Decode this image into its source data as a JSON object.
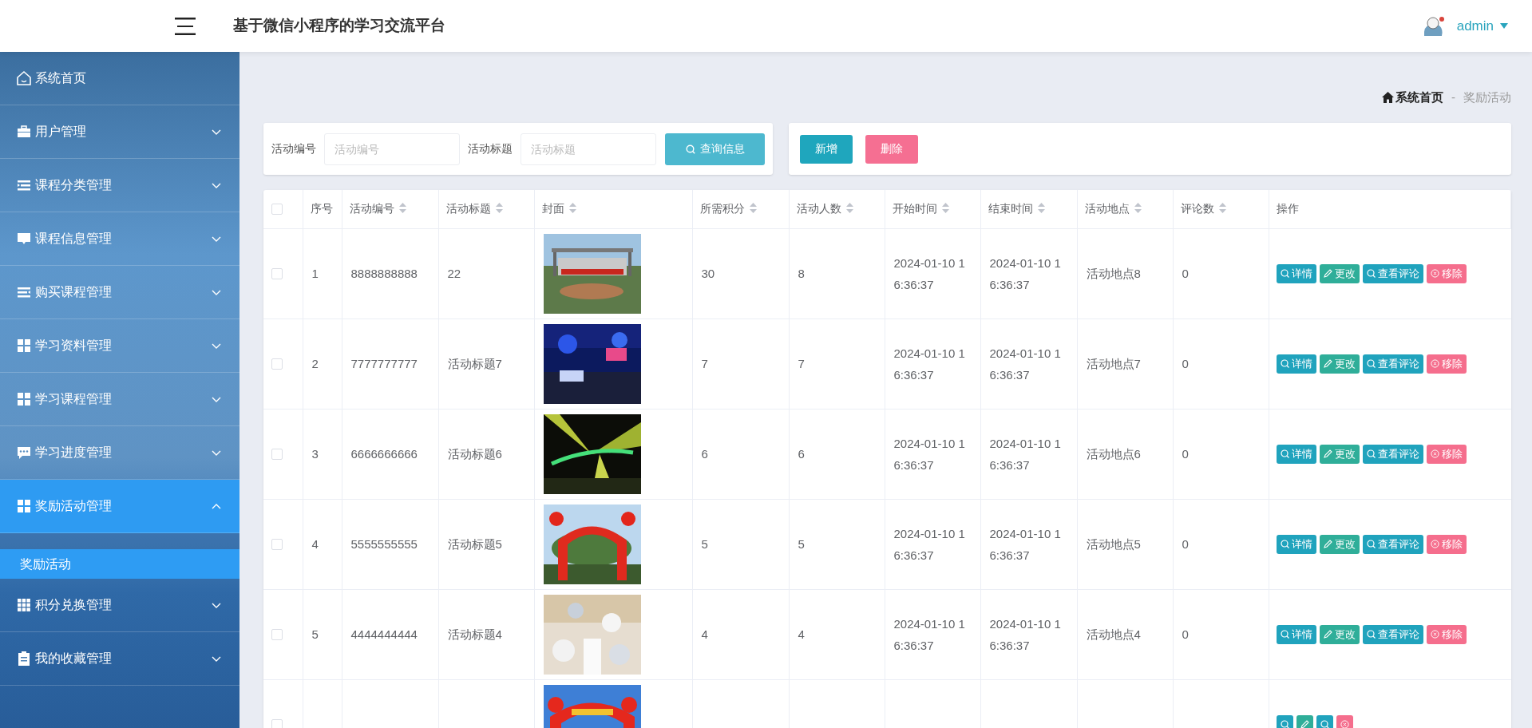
{
  "header": {
    "title": "基于微信小程序的学习交流平台",
    "user": "admin"
  },
  "sidebar": {
    "items": [
      {
        "label": "系统首页",
        "selected": false
      },
      {
        "label": "用户管理",
        "expanded": false,
        "selected": false
      },
      {
        "label": "课程分类管理",
        "expanded": false,
        "selected": false
      },
      {
        "label": "课程信息管理",
        "expanded": false,
        "selected": false
      },
      {
        "label": "购买课程管理",
        "expanded": false,
        "selected": false
      },
      {
        "label": "学习资料管理",
        "expanded": false,
        "selected": false
      },
      {
        "label": "学习课程管理",
        "expanded": false,
        "selected": false
      },
      {
        "label": "学习进度管理",
        "expanded": false,
        "selected": false
      },
      {
        "label": "奖励活动管理",
        "expanded": true,
        "selected": true,
        "children": [
          {
            "label": "奖励活动",
            "selected": true
          }
        ]
      },
      {
        "label": "积分兑换管理",
        "expanded": false,
        "selected": false
      },
      {
        "label": "我的收藏管理",
        "expanded": false,
        "selected": false
      }
    ]
  },
  "breadcrumb": [
    "系统首页",
    "-",
    "奖励活动"
  ],
  "search": {
    "fields": [
      {
        "label": "活动编号",
        "placeholder": "活动编号"
      },
      {
        "label": "活动标题",
        "placeholder": "活动标题"
      }
    ],
    "button": "查询信息"
  },
  "actions": [
    {
      "label": "新增",
      "kind": "primary"
    },
    {
      "label": "删除",
      "kind": "danger"
    }
  ],
  "table": {
    "all_checked": false,
    "columns": [
      {
        "label": "序号",
        "sortable": false
      },
      {
        "label": "活动编号",
        "sortable": true
      },
      {
        "label": "活动标题",
        "sortable": true
      },
      {
        "label": "封面",
        "sortable": true
      },
      {
        "label": "所需积分",
        "sortable": true
      },
      {
        "label": "活动人数",
        "sortable": true
      },
      {
        "label": "开始时间",
        "sortable": true
      },
      {
        "label": "结束时间",
        "sortable": true
      },
      {
        "label": "活动地点",
        "sortable": true
      },
      {
        "label": "评论数",
        "sortable": true
      },
      {
        "label": "操作",
        "sortable": false
      }
    ],
    "rows": [
      {
        "checked": false,
        "cells": [
          "1",
          "8888888888",
          "22",
          {
            "kind": "picture"
          },
          "30",
          "8",
          "2024-01-10 16:36:37",
          "2024-01-10 16:36:37",
          "活动地点8",
          "0"
        ],
        "actions": [
          {
            "label": "详情",
            "kind": "view"
          },
          {
            "label": "更改",
            "kind": "edit"
          },
          {
            "label": "查看评论",
            "kind": "view"
          },
          {
            "label": "移除",
            "kind": "delete"
          }
        ]
      },
      {
        "checked": false,
        "cells": [
          "2",
          "7777777777",
          "活动标题7",
          {
            "kind": "picture"
          },
          "7",
          "7",
          "2024-01-10 16:36:37",
          "2024-01-10 16:36:37",
          "活动地点7",
          "0"
        ],
        "actions": [
          {
            "label": "详情",
            "kind": "view"
          },
          {
            "label": "更改",
            "kind": "edit"
          },
          {
            "label": "查看评论",
            "kind": "view"
          },
          {
            "label": "移除",
            "kind": "delete"
          }
        ]
      },
      {
        "checked": false,
        "cells": [
          "3",
          "6666666666",
          "活动标题6",
          {
            "kind": "picture"
          },
          "6",
          "6",
          "2024-01-10 16:36:37",
          "2024-01-10 16:36:37",
          "活动地点6",
          "0"
        ],
        "actions": [
          {
            "label": "详情",
            "kind": "view"
          },
          {
            "label": "更改",
            "kind": "edit"
          },
          {
            "label": "查看评论",
            "kind": "view"
          },
          {
            "label": "移除",
            "kind": "delete"
          }
        ]
      },
      {
        "checked": false,
        "cells": [
          "4",
          "5555555555",
          "活动标题5",
          {
            "kind": "picture"
          },
          "5",
          "5",
          "2024-01-10 16:36:37",
          "2024-01-10 16:36:37",
          "活动地点5",
          "0"
        ],
        "actions": [
          {
            "label": "详情",
            "kind": "view"
          },
          {
            "label": "更改",
            "kind": "edit"
          },
          {
            "label": "查看评论",
            "kind": "view"
          },
          {
            "label": "移除",
            "kind": "delete"
          }
        ]
      },
      {
        "checked": false,
        "cells": [
          "5",
          "4444444444",
          "活动标题4",
          {
            "kind": "picture"
          },
          "4",
          "4",
          "2024-01-10 16:36:37",
          "2024-01-10 16:36:37",
          "活动地点4",
          "0"
        ],
        "actions": [
          {
            "label": "详情",
            "kind": "view"
          },
          {
            "label": "更改",
            "kind": "edit"
          },
          {
            "label": "查看评论",
            "kind": "view"
          },
          {
            "label": "移除",
            "kind": "delete"
          }
        ]
      },
      {
        "checked": false,
        "cells": [
          null,
          null,
          null,
          {
            "kind": "picture"
          },
          null,
          null,
          null,
          null,
          null,
          null
        ],
        "actions": [
          {
            "kind": "view"
          },
          {
            "kind": "edit"
          },
          {
            "kind": "view"
          },
          {
            "kind": "delete"
          }
        ]
      }
    ]
  }
}
